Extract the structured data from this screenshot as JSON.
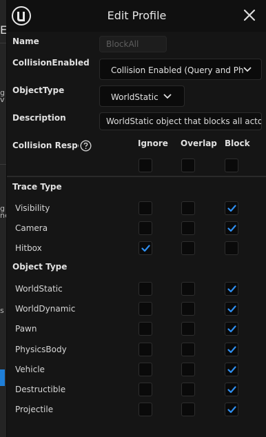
{
  "dialog": {
    "title": "Edit Profile"
  },
  "fields": {
    "name_label": "Name",
    "name_value": "BlockAll",
    "collision_enabled_label": "CollisionEnabled",
    "collision_enabled_value": "Collision Enabled (Query and Ph",
    "object_type_label": "ObjectType",
    "object_type_value": "WorldStatic",
    "description_label": "Description",
    "description_value": "WorldStatic object that blocks all actor"
  },
  "responses": {
    "header_label": "Collision Respor",
    "columns": [
      "Ignore",
      "Overlap",
      "Block"
    ],
    "header_checks": [
      false,
      false,
      false
    ]
  },
  "trace_type": {
    "title": "Trace Type",
    "rows": [
      {
        "label": "Visibility",
        "checks": [
          false,
          false,
          true
        ]
      },
      {
        "label": "Camera",
        "checks": [
          false,
          false,
          true
        ]
      },
      {
        "label": "Hitbox",
        "checks": [
          true,
          false,
          false
        ]
      }
    ]
  },
  "object_type": {
    "title": "Object Type",
    "rows": [
      {
        "label": "WorldStatic",
        "checks": [
          false,
          false,
          true
        ]
      },
      {
        "label": "WorldDynamic",
        "checks": [
          false,
          false,
          true
        ]
      },
      {
        "label": "Pawn",
        "checks": [
          false,
          false,
          true
        ]
      },
      {
        "label": "PhysicsBody",
        "checks": [
          false,
          false,
          true
        ]
      },
      {
        "label": "Vehicle",
        "checks": [
          false,
          false,
          true
        ]
      },
      {
        "label": "Destructible",
        "checks": [
          false,
          false,
          true
        ]
      },
      {
        "label": "Projectile",
        "checks": [
          false,
          false,
          true
        ]
      }
    ]
  },
  "background": {
    "fragments": [
      "E",
      "g",
      "v",
      "g",
      "ne",
      "s"
    ]
  },
  "colors": {
    "check_accent": "#2f8ff0",
    "dialog_bg": "#151515"
  }
}
